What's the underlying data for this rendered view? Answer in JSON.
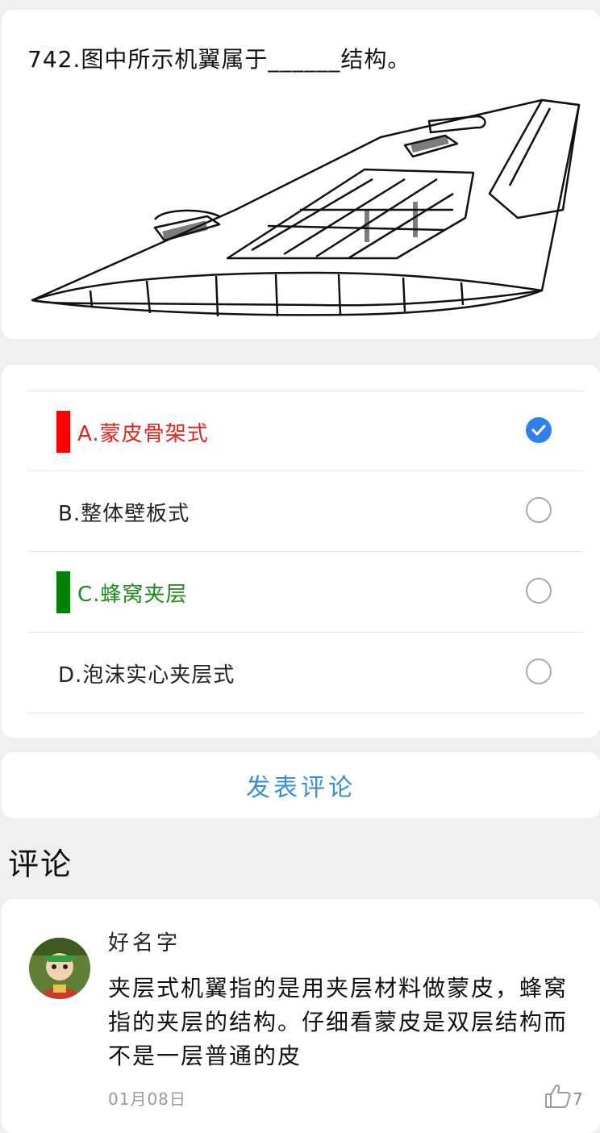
{
  "question": {
    "title": "742.图中所示机翼属于______结构。"
  },
  "options": [
    {
      "label": "A.蒙皮骨架式",
      "color": "#e8201a",
      "marker_color": "#ff0000",
      "selected": true
    },
    {
      "label": "B.整体壁板式",
      "color": "#222222",
      "marker_color": "",
      "selected": false
    },
    {
      "label": "C.蜂窝夹层",
      "color": "#1e8a1e",
      "marker_color": "#008000",
      "selected": false
    },
    {
      "label": "D.泡沫实心夹层式",
      "color": "#222222",
      "marker_color": "",
      "selected": false
    }
  ],
  "post_comment_label": "发表评论",
  "comments_heading": "评论",
  "comment": {
    "username": "好名字",
    "text": "夹层式机翼指的是用夹层材料做蒙皮，蜂窝指的夹层的结构。仔细看蒙皮是双层结构而不是一层普通的皮",
    "date": "01月08日",
    "likes": "7"
  },
  "icons": {
    "check": "checkmark-icon",
    "like": "thumbs-up-icon"
  },
  "colors": {
    "accent": "#2f80ed",
    "link": "#3b8fd9",
    "background": "#efefef"
  }
}
